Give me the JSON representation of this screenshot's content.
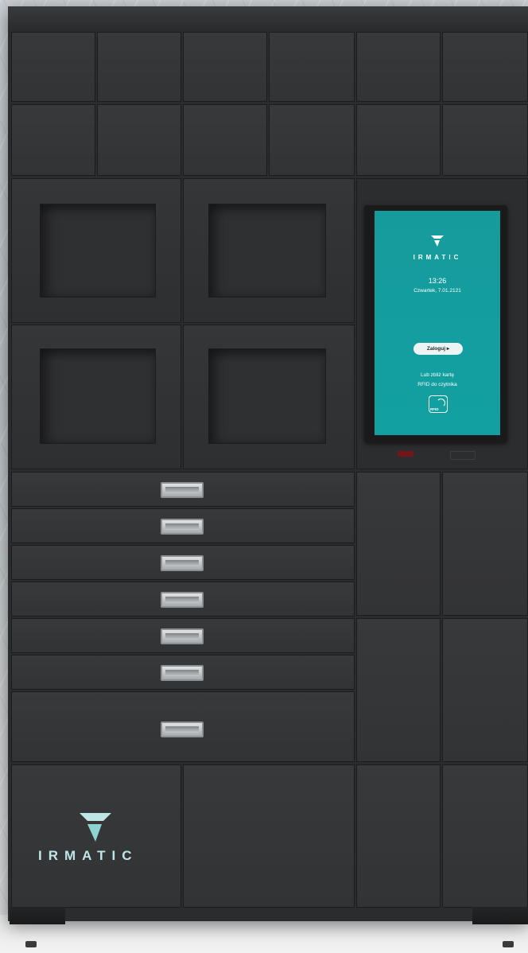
{
  "screen": {
    "brand": "IRMATIC",
    "time": "13:26",
    "date": "Czwartek, 7.01.2121",
    "login_button": "Zaloguj ▸",
    "rfid_hint_line1": "Lub zbliż kartę",
    "rfid_hint_line2": "RFID do czytnika",
    "rfid_icon_label": "RFID",
    "accent_color": "#12a0a1"
  },
  "cabinet": {
    "brand": "IRMATIC",
    "logo_color": "#bfe6e6",
    "body_color": "#2b2c2e"
  }
}
